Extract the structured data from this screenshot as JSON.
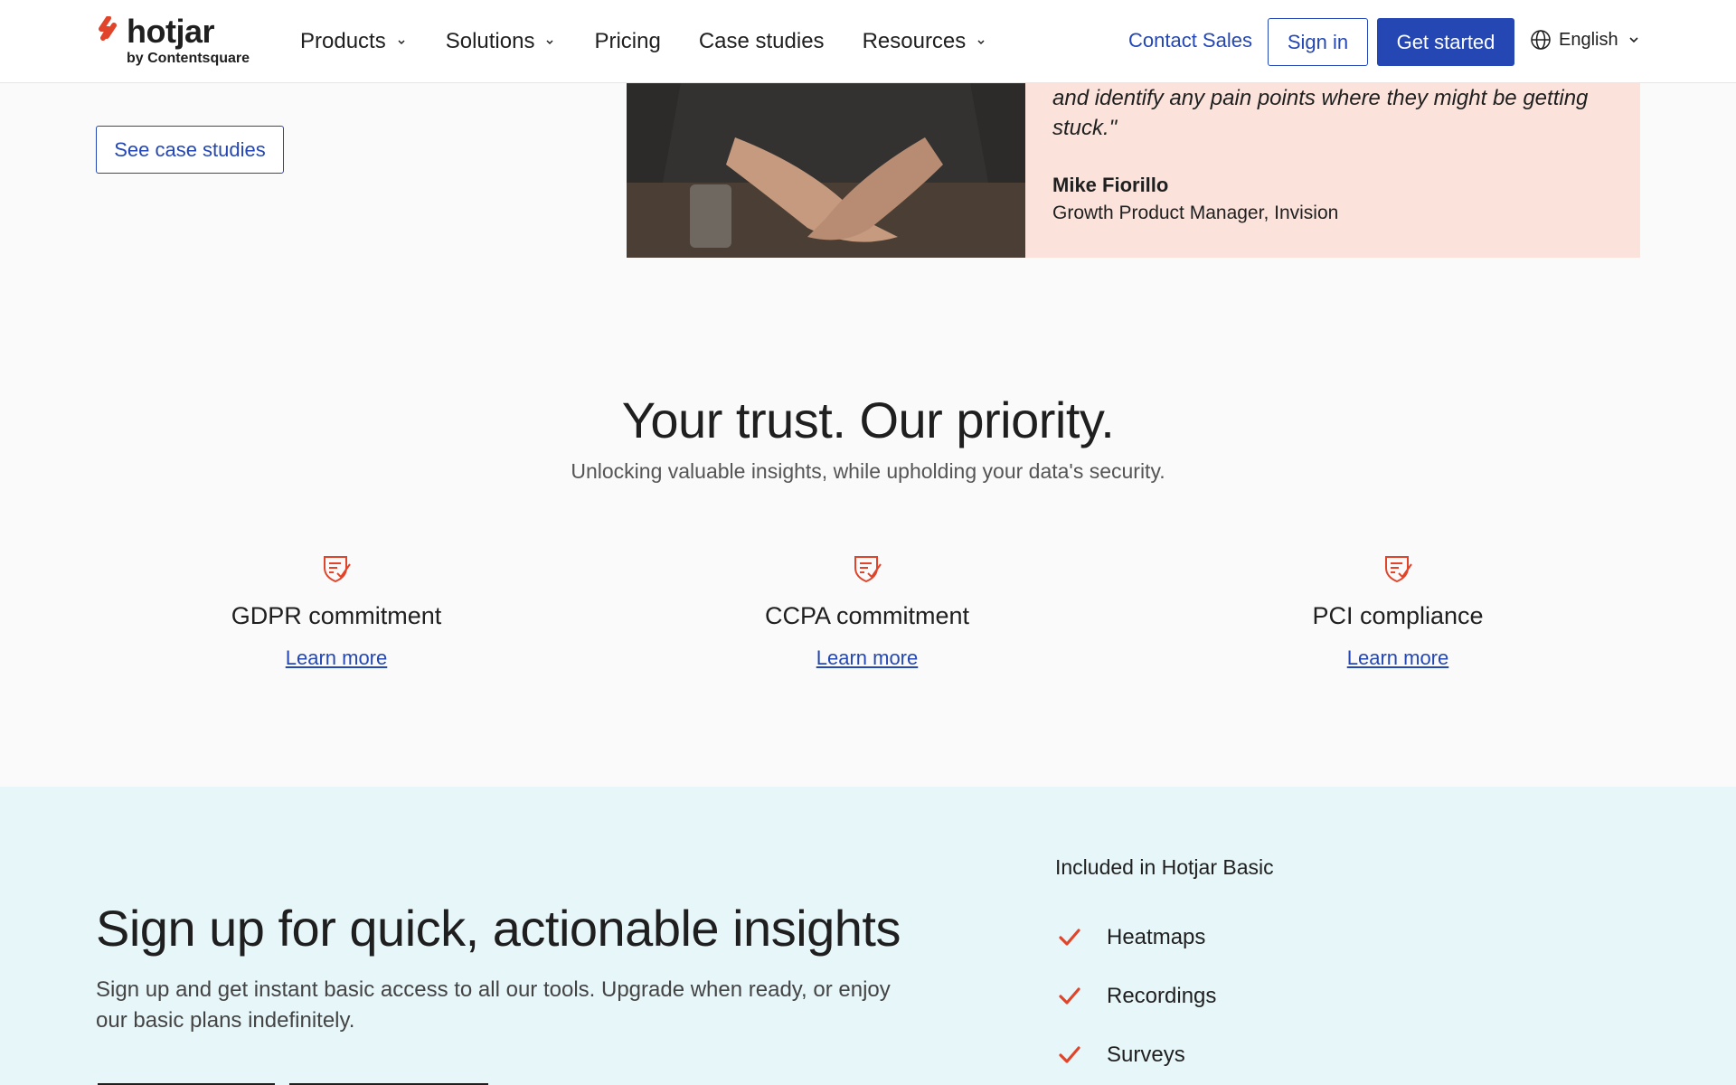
{
  "nav": {
    "logo_word": "hotjar",
    "logo_sub": "by Contentsquare",
    "links": [
      {
        "label": "Products",
        "dropdown": true
      },
      {
        "label": "Solutions",
        "dropdown": true
      },
      {
        "label": "Pricing",
        "dropdown": false
      },
      {
        "label": "Case studies",
        "dropdown": false
      },
      {
        "label": "Resources",
        "dropdown": true
      }
    ],
    "contact_sales": "Contact Sales",
    "sign_in": "Sign in",
    "get_started": "Get started",
    "language": "English"
  },
  "case_studies": {
    "button": "See case studies",
    "quote": "and identify any pain points where they might be getting stuck.\"",
    "author_name": "Mike Fiorillo",
    "author_role": "Growth Product Manager, Invision"
  },
  "trust": {
    "title": "Your trust. Our priority.",
    "subtitle": "Unlocking valuable insights, while upholding your data's security.",
    "cards": [
      {
        "title": "GDPR commitment",
        "link": "Learn more"
      },
      {
        "title": "CCPA commitment",
        "link": "Learn more"
      },
      {
        "title": "PCI compliance",
        "link": "Learn more"
      }
    ]
  },
  "signup": {
    "title": "Sign up for quick, actionable insights",
    "description": "Sign up and get instant basic access to all our tools. Upgrade when ready, or enjoy our basic plans indefinitely.",
    "included_title": "Included in Hotjar Basic",
    "included": [
      "Heatmaps",
      "Recordings",
      "Surveys"
    ]
  },
  "colors": {
    "accent_blue": "#2447b3",
    "brand_red": "#e0452b",
    "testimonial_bg": "#fbe3dc",
    "signup_bg": "#e7f6f9"
  },
  "icons": {
    "logo": "hotjar-logo-icon",
    "chevron": "chevron-down-icon",
    "globe": "globe-icon",
    "shield": "shield-check-icon",
    "check": "check-icon"
  }
}
